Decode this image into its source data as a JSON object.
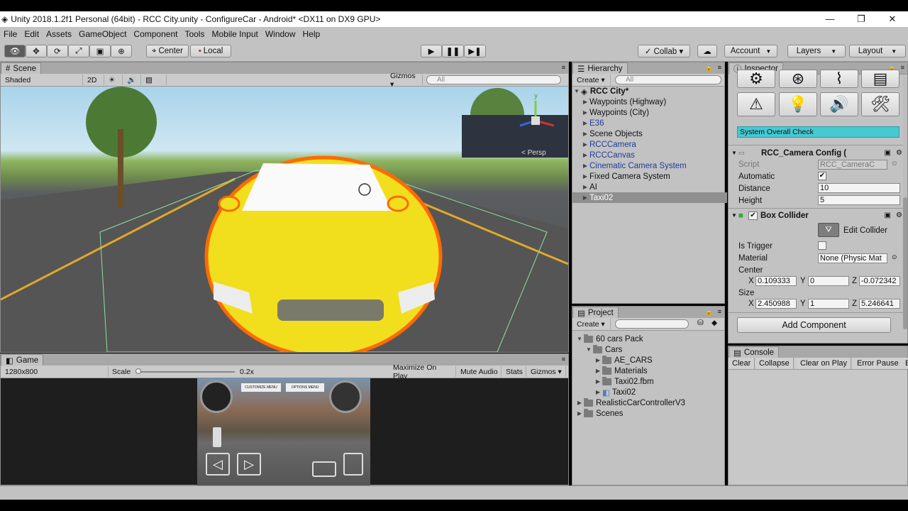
{
  "window": {
    "title": "Unity 2018.1.2f1 Personal (64bit) - RCC City.unity - ConfigureCar - Android* <DX11 on DX9 GPU>",
    "minimize": "—",
    "restore": "❐",
    "close": "✕"
  },
  "menu": [
    "File",
    "Edit",
    "Assets",
    "GameObject",
    "Component",
    "Tools",
    "Mobile Input",
    "Window",
    "Help"
  ],
  "toolbar": {
    "center": "Center",
    "local": "Local",
    "collab": "Collab ▾",
    "account": "Account",
    "layers": "Layers",
    "layout": "Layout"
  },
  "scene": {
    "tab": "Scene",
    "shading": "Shaded",
    "mode2d": "2D",
    "gizmos": "Gizmos ▾",
    "search_placeholder": "All",
    "persp": "< Persp"
  },
  "game": {
    "tab": "Game",
    "resolution": "1280x800",
    "scale_label": "Scale",
    "scale_value": "0.2x",
    "maximize": "Maximize On Play",
    "mute": "Mute Audio",
    "stats": "Stats",
    "gizmos": "Gizmos ▾",
    "hud_customize": "CUSTOMIZE MENU",
    "hud_options": "OPTIONS MENU"
  },
  "hierarchy": {
    "tab": "Hierarchy",
    "create": "Create ▾",
    "search_placeholder": "All",
    "root": "RCC City*",
    "items": [
      {
        "label": "Waypoints (Highway)",
        "prefab": false
      },
      {
        "label": "Waypoints (City)",
        "prefab": false
      },
      {
        "label": "E36",
        "prefab": true
      },
      {
        "label": "Scene Objects",
        "prefab": false
      },
      {
        "label": "RCCCamera",
        "prefab": true
      },
      {
        "label": "RCCCanvas",
        "prefab": true
      },
      {
        "label": "Cinematic Camera System",
        "prefab": true
      },
      {
        "label": "Fixed Camera System",
        "prefab": false
      },
      {
        "label": "AI",
        "prefab": false
      },
      {
        "label": "Taxi02",
        "prefab": false,
        "selected": true
      }
    ]
  },
  "project": {
    "tab": "Project",
    "create": "Create ▾",
    "items": [
      "60 cars Pack",
      "Cars",
      "AE_CARS",
      "Materials",
      "Taxi02.fbm",
      "Taxi02",
      "RealisticCarControllerV3",
      "Scenes"
    ]
  },
  "inspector": {
    "tab": "Inspector",
    "system_check": "System Overall Check",
    "camera_config": {
      "title": "RCC_Camera Config (",
      "script_label": "Script",
      "script_value": "RCC_CameraC",
      "automatic_label": "Automatic",
      "automatic": true,
      "distance_label": "Distance",
      "distance": "10",
      "height_label": "Height",
      "height": "5"
    },
    "box_collider": {
      "title": "Box Collider",
      "edit": "Edit Collider",
      "trigger_label": "Is Trigger",
      "is_trigger": false,
      "material_label": "Material",
      "material": "None (Physic Mat",
      "center_label": "Center",
      "center": {
        "x": "0.109333",
        "y": "0",
        "z": "-0.072342"
      },
      "size_label": "Size",
      "size": {
        "x": "2.450988",
        "y": "1",
        "z": "5.246641"
      }
    },
    "add_component": "Add Component"
  },
  "console": {
    "tab": "Console",
    "buttons": [
      "Clear",
      "Collapse",
      "Clear on Play",
      "Error Pause",
      "Edi"
    ]
  }
}
